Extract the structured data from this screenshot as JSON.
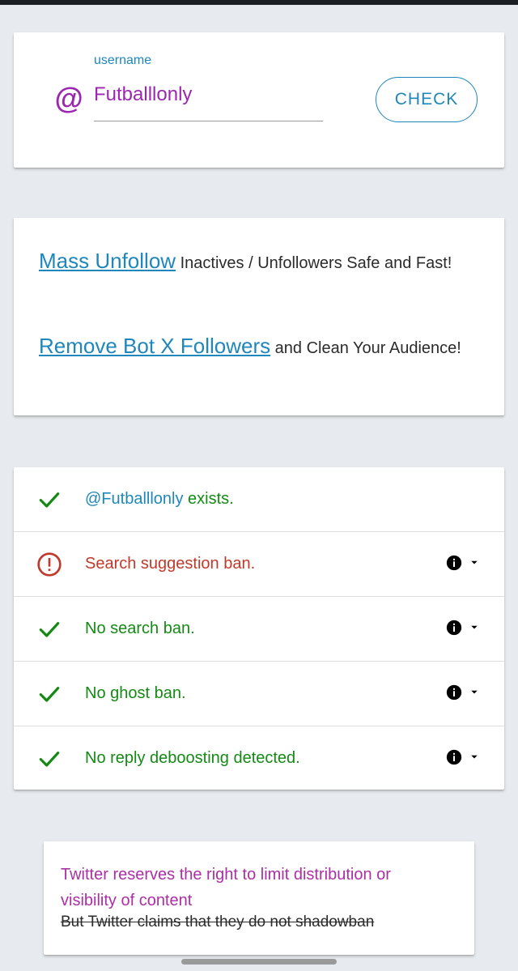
{
  "search": {
    "at_symbol": "@",
    "label": "username",
    "value": "Futballlonly",
    "check_label": "CHECK"
  },
  "promo": {
    "line1_link": "Mass Unfollow",
    "line1_rest": " Inactives / Unfollowers Safe and Fast!",
    "line2_link": "Remove Bot X Followers",
    "line2_rest": " and Clean Your Audience!"
  },
  "results": {
    "exists_handle": "@Futballlonly",
    "exists_text": " exists.",
    "search_suggestion": "Search suggestion ban.",
    "search_ban": "No search ban.",
    "ghost_ban": "No ghost ban.",
    "reply_deboosting": "No reply deboosting detected."
  },
  "notice": {
    "main": "Twitter reserves the right to limit distribution or visibility of content",
    "struck": "But Twitter claims that they do not shadowban"
  },
  "colors": {
    "accent_purple": "#9c27b0",
    "link_blue": "#1f87bb",
    "ok_green": "#148a14",
    "error_red": "#c0392b"
  },
  "icons": [
    "at-icon",
    "check-icon",
    "error-circle-icon",
    "info-icon",
    "caret-down-icon"
  ]
}
